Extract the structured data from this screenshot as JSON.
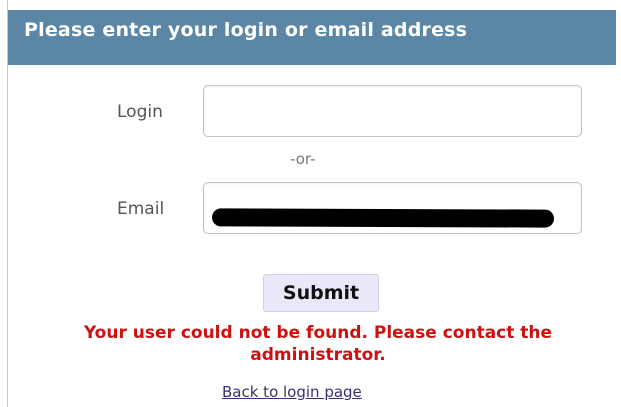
{
  "form": {
    "header_title": "Please enter your login or email address",
    "login_label": "Login",
    "login_value": "",
    "separator": "-or-",
    "email_label": "Email",
    "email_value": "",
    "submit_label": "Submit",
    "error_message": "Your user could not be found. Please contact the administrator.",
    "back_link": "Back to login page"
  },
  "colors": {
    "header_bg": "#5b86a6",
    "error_text": "#cc1111",
    "link_text": "#3b2f7a",
    "submit_bg": "#e8e8f8"
  }
}
